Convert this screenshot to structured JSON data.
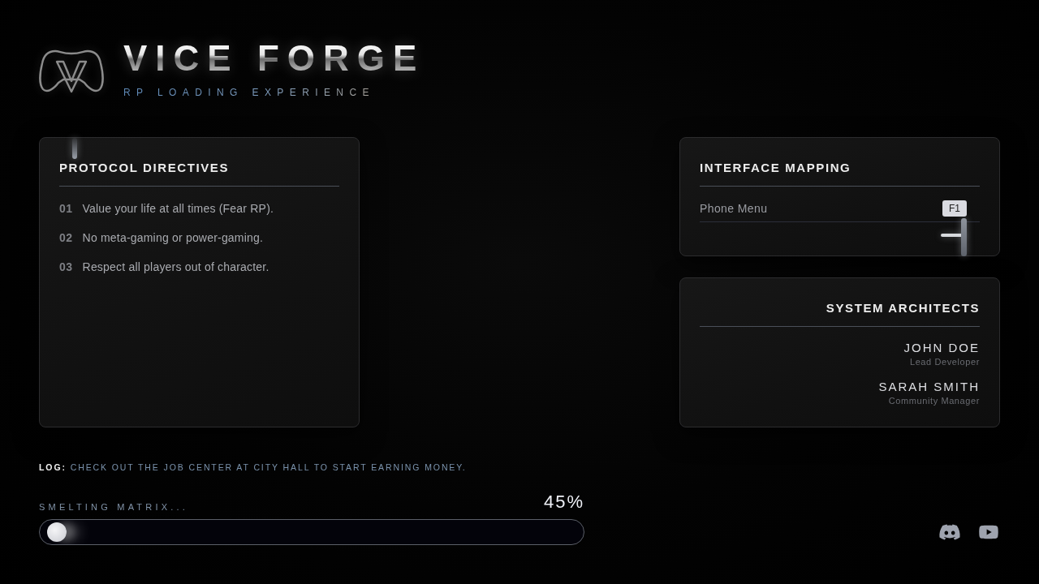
{
  "header": {
    "title": "VICE FORGE",
    "subtitle": "RP LOADING EXPERIENCE"
  },
  "protocol_panel": {
    "title": "PROTOCOL DIRECTIVES",
    "rules": [
      {
        "number": "01",
        "text": "Value your life at all times (Fear RP)."
      },
      {
        "number": "02",
        "text": "No meta-gaming or power-gaming."
      },
      {
        "number": "03",
        "text": "Respect all players out of character."
      }
    ]
  },
  "interface_panel": {
    "title": "INTERFACE MAPPING",
    "bindings": [
      {
        "action": "Phone Menu",
        "key": "F1"
      }
    ]
  },
  "architects_panel": {
    "title": "SYSTEM ARCHITECTS",
    "members": [
      {
        "name": "JOHN DOE",
        "role": "Lead Developer"
      },
      {
        "name": "SARAH SMITH",
        "role": "Community Manager"
      }
    ]
  },
  "log": {
    "text": "**LOG:** CHECK OUT THE JOB CENTER AT CITY HALL TO START EARNING MONEY."
  },
  "progress": {
    "label": "SMELTING MATRIX...",
    "percent": "45%",
    "level": 0.01
  }
}
